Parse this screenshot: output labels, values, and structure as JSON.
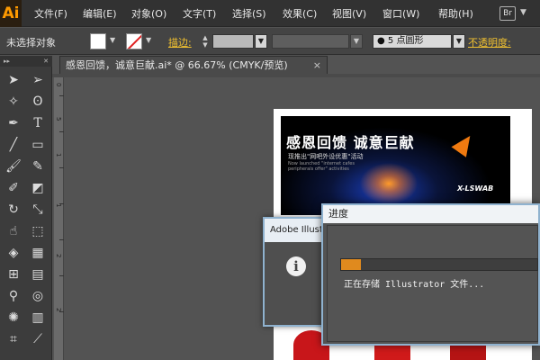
{
  "app": {
    "logo_text": "Ai",
    "bridge_label": "Br",
    "dropdown_icon": "triangle-down"
  },
  "menu": {
    "items": [
      "文件(F)",
      "编辑(E)",
      "对象(O)",
      "文字(T)",
      "选择(S)",
      "效果(C)",
      "视图(V)",
      "窗口(W)",
      "帮助(H)"
    ]
  },
  "control_bar": {
    "selection_label": "未选择对象",
    "fill_color": "#ffffff",
    "stroke_color": "none",
    "stroke_label": "描边:",
    "stroke_weight": "",
    "brush_select": "● 5 点圆形",
    "opacity_label": "不透明度:"
  },
  "toolbar": {
    "tools": [
      "selection-tool",
      "direct-selection-tool",
      "magic-wand-tool",
      "lasso-tool",
      "pen-tool",
      "type-tool",
      "line-tool",
      "rectangle-tool",
      "paintbrush-tool",
      "pencil-tool",
      "blob-brush-tool",
      "eraser-tool",
      "rotate-tool",
      "scale-tool",
      "warp-tool",
      "free-transform-tool",
      "shape-builder-tool",
      "perspective-grid-tool",
      "mesh-tool",
      "gradient-tool",
      "eyedropper-tool",
      "blend-tool",
      "symbol-sprayer-tool",
      "column-graph-tool",
      "artboard-tool",
      "slice-tool"
    ]
  },
  "document": {
    "tab_title": "感恩回馈，诚意巨献.ai* @ 66.67% (CMYK/预览)",
    "close_label": "×",
    "ruler_numbers": [
      "0",
      "5",
      "1",
      "1",
      "2",
      "2"
    ]
  },
  "artwork": {
    "title": "感恩回馈 诚意巨献",
    "subtitle": "现推出\"网吧外设优惠\"活动",
    "english_lines": "Now launched \"internet cafes peripherals offer\" activities",
    "brand_logo": "X-LSWAB"
  },
  "adobe_dialog": {
    "title": "Adobe Illustrator",
    "icon": "info-icon"
  },
  "progress_dialog": {
    "title": "进度",
    "progress": 0.1,
    "status": "正在存储 Illustrator 文件..."
  },
  "colors": {
    "accent": "#e08a1e",
    "menu_bg": "#323232",
    "panel_bg": "#444444",
    "canvas_bg": "#535353",
    "dialog_border": "#8fb2cf"
  }
}
